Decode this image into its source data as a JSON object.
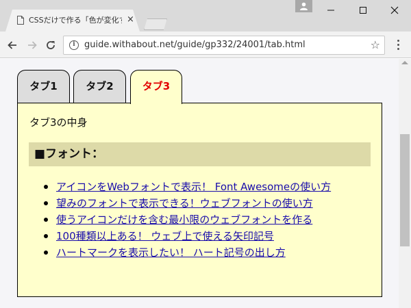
{
  "browser": {
    "tab_title": "CSSだけで作る「色が変化す",
    "tab_close": "×",
    "url": "guide.withabout.net/guide/gp332/24001/tab.html",
    "minimize": "—",
    "maximize": "☐",
    "close": "✕",
    "back": "←",
    "forward": "→",
    "reload": "↻",
    "info": "i",
    "star": "☆"
  },
  "tabs": [
    {
      "label": "タブ1",
      "active": false
    },
    {
      "label": "タブ2",
      "active": false
    },
    {
      "label": "タブ3",
      "active": true
    }
  ],
  "panel": {
    "heading": "タブ3の中身",
    "section_title": "■フォント："
  },
  "links": [
    "アイコンをWebフォントで表示！ Font Awesomeの使い方",
    "望みのフォントで表示できる！ウェブフォントの使い方",
    "使うアイコンだけを含む最小限のウェブフォントを作る",
    "100種類以上ある！ ウェブ上で使える矢印記号",
    "ハートマークを表示したい！ ハート記号の出し方"
  ],
  "colors": {
    "panel_bg": "#ffffcc",
    "section_bg": "#dddaa8",
    "active_tab_text": "#e20000",
    "inactive_tab_bg": "#dddddd",
    "link": "#1a0dab"
  }
}
